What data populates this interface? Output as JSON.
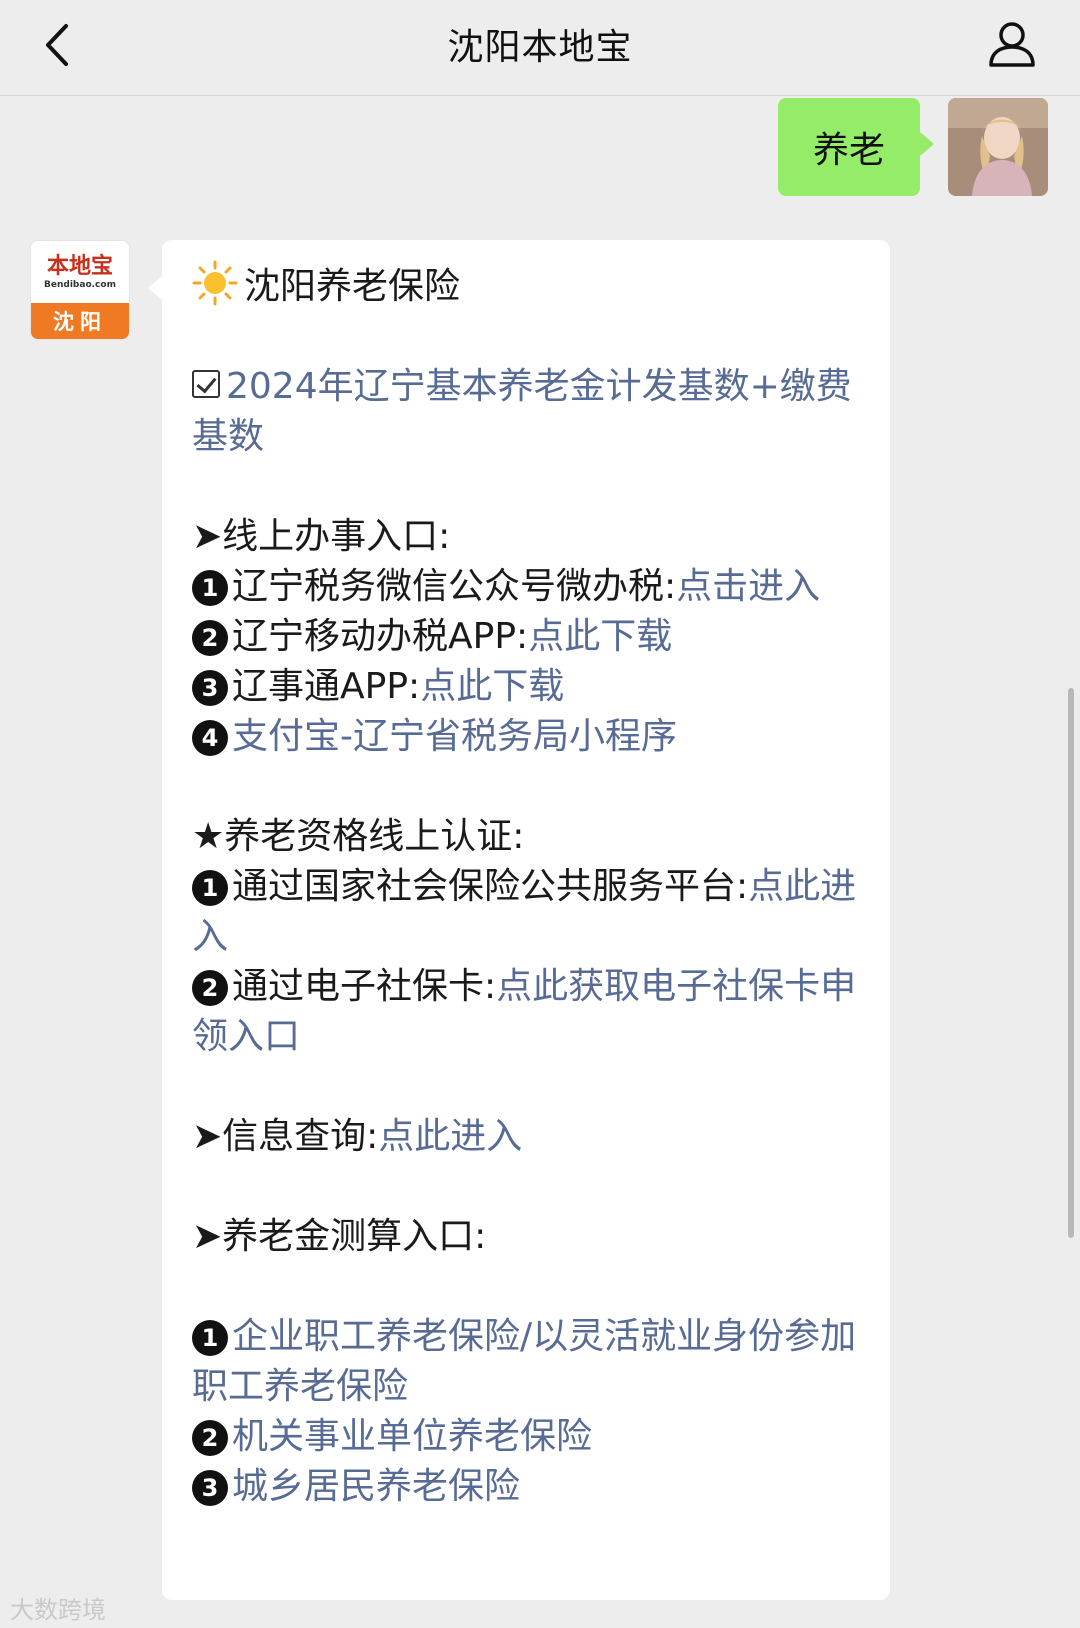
{
  "header": {
    "title": "沈阳本地宝",
    "back_icon": "chevron-left-icon",
    "profile_icon": "user-icon"
  },
  "user_message": {
    "text": "养老"
  },
  "bot": {
    "logo_name": "本地宝",
    "logo_domain": "Bendibao.com",
    "logo_city": "沈阳"
  },
  "reply": {
    "title": "沈阳养老保险",
    "item_2024": "2024年辽宁基本养老金计发基数+缴费基数",
    "online": {
      "heading": "➤线上办事入口:",
      "items": [
        {
          "num": "1",
          "text": "辽宁税务微信公众号微办税:",
          "link": "点击进入"
        },
        {
          "num": "2",
          "text": "辽宁移动办税APP:",
          "link": "点此下载"
        },
        {
          "num": "3",
          "text": "辽事通APP:",
          "link": "点此下载"
        },
        {
          "num": "4",
          "text": "",
          "link": "支付宝-辽宁省税务局小程序"
        }
      ]
    },
    "certify": {
      "heading": "★养老资格线上认证:",
      "items": [
        {
          "num": "1",
          "text": "通过国家社会保险公共服务平台:",
          "link": "点此进入"
        },
        {
          "num": "2",
          "text": "通过电子社保卡:",
          "link": "点此获取电子社保卡申领入口"
        }
      ]
    },
    "info": {
      "heading": "➤信息查询:",
      "link": "点此进入"
    },
    "calc": {
      "heading": "➤养老金测算入口:",
      "items": [
        {
          "num": "1",
          "link": "企业职工养老保险/以灵活就业身份参加职工养老保险"
        },
        {
          "num": "2",
          "link": "机关事业单位养老保险"
        },
        {
          "num": "3",
          "link": "城乡居民养老保险"
        }
      ]
    }
  },
  "watermark": "大数跨境",
  "colors": {
    "link": "#576b95",
    "user_bubble": "#95ec69",
    "background": "#ededed"
  }
}
